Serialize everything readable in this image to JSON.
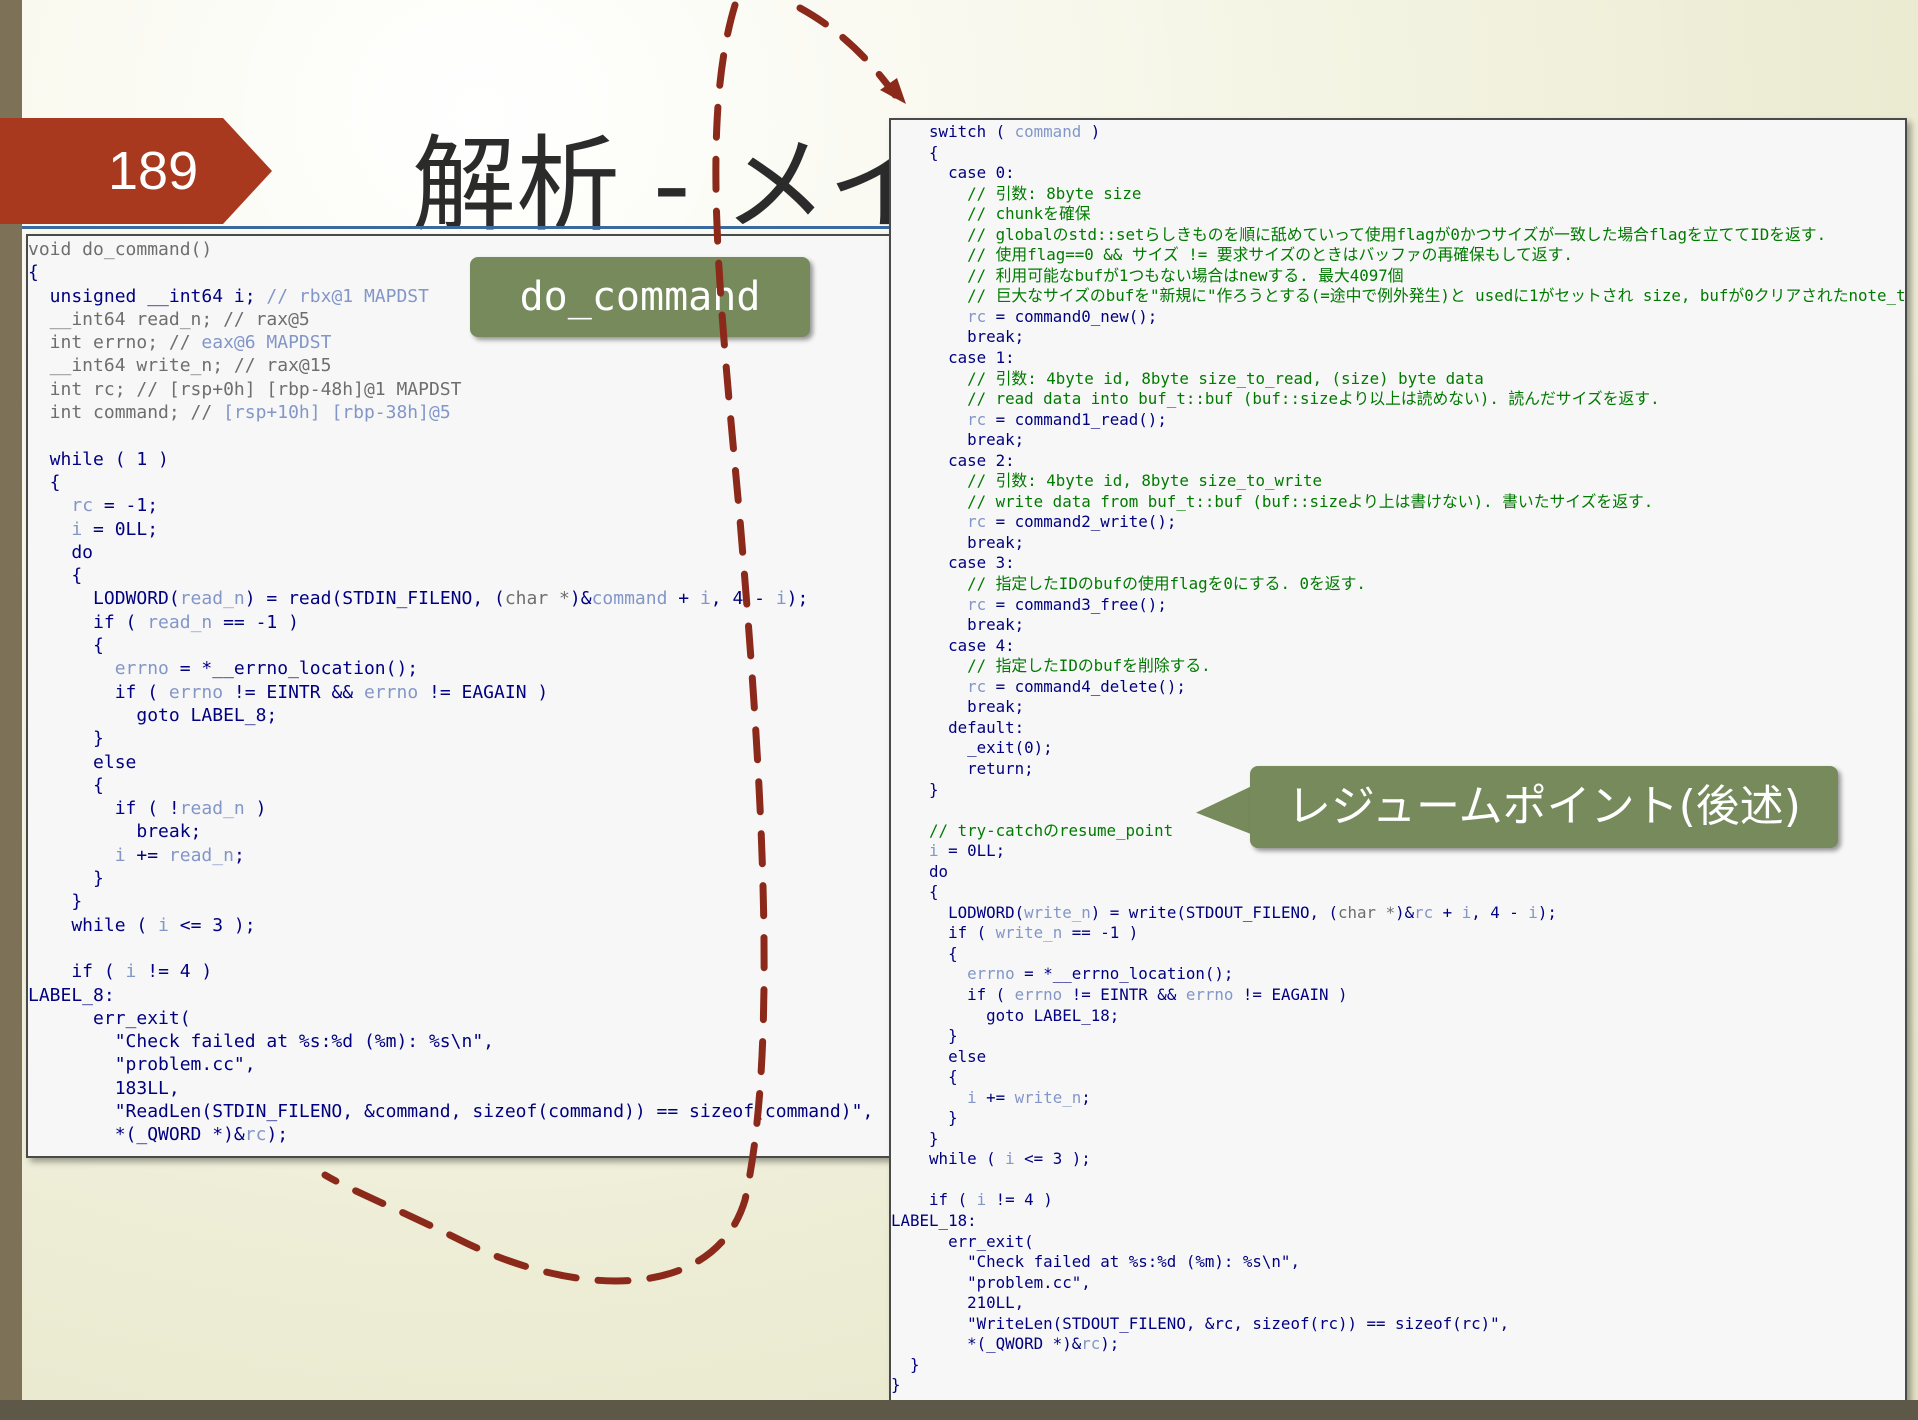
{
  "slide": {
    "number": "189",
    "title": "解析 - メインの機能の解析"
  },
  "callouts": {
    "do_command": "do_command",
    "resume_point": "レジュームポイント(後述)"
  },
  "colors": {
    "slide_number_tab": "#a8391f",
    "callout": "#768a5c",
    "arrow": "#8b2a1a",
    "code_keyword": "#000080",
    "code_variable": "#8296c8",
    "code_comment": "#007a00"
  },
  "code_left": {
    "lines": [
      [
        {
          "t": "void do_command()",
          "c": "dim"
        }
      ],
      [
        {
          "t": "{",
          "c": "kw"
        }
      ],
      [
        {
          "t": "  unsigned __int64 i; ",
          "c": "kw"
        },
        {
          "t": "// rbx@1 MAPDST",
          "c": "var"
        }
      ],
      [
        {
          "t": "  __int64 read_n; // rax@5",
          "c": "dim"
        }
      ],
      [
        {
          "t": "  int errno; // ",
          "c": "dim"
        },
        {
          "t": "eax@6 MAPDST",
          "c": "var"
        }
      ],
      [
        {
          "t": "  __int64 write_n; // rax@15",
          "c": "dim"
        }
      ],
      [
        {
          "t": "  int rc; // [rsp+0h] [rbp-48h]@1 MAPDST",
          "c": "dim"
        }
      ],
      [
        {
          "t": "  int command; // ",
          "c": "dim"
        },
        {
          "t": "[rsp+10h] [rbp-38h]@5",
          "c": "var"
        }
      ],
      [
        {
          "t": "",
          "c": "kw"
        }
      ],
      [
        {
          "t": "  while ( 1 )",
          "c": "kw"
        }
      ],
      [
        {
          "t": "  {",
          "c": "kw"
        }
      ],
      [
        {
          "t": "    ",
          "c": "kw"
        },
        {
          "t": "rc",
          "c": "var"
        },
        {
          "t": " = -1;",
          "c": "kw"
        }
      ],
      [
        {
          "t": "    ",
          "c": "kw"
        },
        {
          "t": "i",
          "c": "var"
        },
        {
          "t": " = 0LL;",
          "c": "kw"
        }
      ],
      [
        {
          "t": "    do",
          "c": "kw"
        }
      ],
      [
        {
          "t": "    {",
          "c": "kw"
        }
      ],
      [
        {
          "t": "      LODWORD(",
          "c": "kw"
        },
        {
          "t": "read_n",
          "c": "var"
        },
        {
          "t": ") = read(STDIN_FILENO, (",
          "c": "kw"
        },
        {
          "t": "char *",
          "c": "dim"
        },
        {
          "t": ")&",
          "c": "kw"
        },
        {
          "t": "command",
          "c": "var"
        },
        {
          "t": " + ",
          "c": "kw"
        },
        {
          "t": "i",
          "c": "var"
        },
        {
          "t": ", 4 - ",
          "c": "kw"
        },
        {
          "t": "i",
          "c": "var"
        },
        {
          "t": ");",
          "c": "kw"
        }
      ],
      [
        {
          "t": "      if ( ",
          "c": "kw"
        },
        {
          "t": "read_n",
          "c": "var"
        },
        {
          "t": " == -1 )",
          "c": "kw"
        }
      ],
      [
        {
          "t": "      {",
          "c": "kw"
        }
      ],
      [
        {
          "t": "        ",
          "c": "kw"
        },
        {
          "t": "errno",
          "c": "var"
        },
        {
          "t": " = *__errno_location();",
          "c": "kw"
        }
      ],
      [
        {
          "t": "        if ( ",
          "c": "kw"
        },
        {
          "t": "errno",
          "c": "var"
        },
        {
          "t": " != EINTR && ",
          "c": "kw"
        },
        {
          "t": "errno",
          "c": "var"
        },
        {
          "t": " != EAGAIN )",
          "c": "kw"
        }
      ],
      [
        {
          "t": "          goto LABEL_8;",
          "c": "kw"
        }
      ],
      [
        {
          "t": "      }",
          "c": "kw"
        }
      ],
      [
        {
          "t": "      else",
          "c": "kw"
        }
      ],
      [
        {
          "t": "      {",
          "c": "kw"
        }
      ],
      [
        {
          "t": "        if ( !",
          "c": "kw"
        },
        {
          "t": "read_n",
          "c": "var"
        },
        {
          "t": " )",
          "c": "kw"
        }
      ],
      [
        {
          "t": "          break;",
          "c": "kw"
        }
      ],
      [
        {
          "t": "        ",
          "c": "kw"
        },
        {
          "t": "i",
          "c": "var"
        },
        {
          "t": " += ",
          "c": "kw"
        },
        {
          "t": "read_n",
          "c": "var"
        },
        {
          "t": ";",
          "c": "kw"
        }
      ],
      [
        {
          "t": "      }",
          "c": "kw"
        }
      ],
      [
        {
          "t": "    }",
          "c": "kw"
        }
      ],
      [
        {
          "t": "    while ( ",
          "c": "kw"
        },
        {
          "t": "i",
          "c": "var"
        },
        {
          "t": " <= 3 );",
          "c": "kw"
        }
      ],
      [
        {
          "t": "",
          "c": "kw"
        }
      ],
      [
        {
          "t": "    if ( ",
          "c": "kw"
        },
        {
          "t": "i",
          "c": "var"
        },
        {
          "t": " != 4 )",
          "c": "kw"
        }
      ],
      [
        {
          "t": "LABEL_8:",
          "c": "kw"
        }
      ],
      [
        {
          "t": "      err_exit(",
          "c": "kw"
        }
      ],
      [
        {
          "t": "        \"Check failed at %s:%d (%m): %s\\n\",",
          "c": "kw"
        }
      ],
      [
        {
          "t": "        \"problem.cc\",",
          "c": "kw"
        }
      ],
      [
        {
          "t": "        183LL,",
          "c": "kw"
        }
      ],
      [
        {
          "t": "        \"ReadLen(STDIN_FILENO, &command, sizeof(command)) == sizeof(command)\",",
          "c": "kw"
        }
      ],
      [
        {
          "t": "        *(_QWORD *)&",
          "c": "kw"
        },
        {
          "t": "rc",
          "c": "var"
        },
        {
          "t": ");",
          "c": "kw"
        }
      ]
    ]
  },
  "code_right": {
    "lines": [
      [
        {
          "t": "    switch ( ",
          "c": "kw"
        },
        {
          "t": "command",
          "c": "var"
        },
        {
          "t": " )",
          "c": "kw"
        }
      ],
      [
        {
          "t": "    {",
          "c": "kw"
        }
      ],
      [
        {
          "t": "      case 0:",
          "c": "kw"
        }
      ],
      [
        {
          "t": "        // 引数: 8byte size",
          "c": "cmt"
        }
      ],
      [
        {
          "t": "        // chunkを確保",
          "c": "cmt"
        }
      ],
      [
        {
          "t": "        // globalのstd::setらしきものを順に舐めていって使用flagが0かつサイズが一致した場合flagを立ててIDを返す.",
          "c": "cmt"
        }
      ],
      [
        {
          "t": "        // 使用flag==0 && サイズ != 要求サイズのときはバッファの再確保もして返す.",
          "c": "cmt"
        }
      ],
      [
        {
          "t": "        // 利用可能なbufが1つもない場合はnewする. 最大4097個",
          "c": "cmt"
        }
      ],
      [
        {
          "t": "        // 巨大なサイズのbufを\"新規に\"作ろうとする(=途中で例外発生)と usedに1がセットされ size, bufが0クリアされたnote_tができる",
          "c": "cmt"
        }
      ],
      [
        {
          "t": "        ",
          "c": "kw"
        },
        {
          "t": "rc",
          "c": "var"
        },
        {
          "t": " = command0_new();",
          "c": "kw"
        }
      ],
      [
        {
          "t": "        break;",
          "c": "kw"
        }
      ],
      [
        {
          "t": "      case 1:",
          "c": "kw"
        }
      ],
      [
        {
          "t": "        // 引数: 4byte id, 8byte size_to_read, (size) byte data",
          "c": "cmt"
        }
      ],
      [
        {
          "t": "        // read data into buf_t::buf (buf::sizeより以上は読めない). 読んだサイズを返す.",
          "c": "cmt"
        }
      ],
      [
        {
          "t": "        ",
          "c": "kw"
        },
        {
          "t": "rc",
          "c": "var"
        },
        {
          "t": " = command1_read();",
          "c": "kw"
        }
      ],
      [
        {
          "t": "        break;",
          "c": "kw"
        }
      ],
      [
        {
          "t": "      case 2:",
          "c": "kw"
        }
      ],
      [
        {
          "t": "        // 引数: 4byte id, 8byte size_to_write",
          "c": "cmt"
        }
      ],
      [
        {
          "t": "        // write data from buf_t::buf (buf::sizeより上は書けない). 書いたサイズを返す.",
          "c": "cmt"
        }
      ],
      [
        {
          "t": "        ",
          "c": "kw"
        },
        {
          "t": "rc",
          "c": "var"
        },
        {
          "t": " = command2_write();",
          "c": "kw"
        }
      ],
      [
        {
          "t": "        break;",
          "c": "kw"
        }
      ],
      [
        {
          "t": "      case 3:",
          "c": "kw"
        }
      ],
      [
        {
          "t": "        // 指定したIDのbufの使用flagを0にする. 0を返す.",
          "c": "cmt"
        }
      ],
      [
        {
          "t": "        ",
          "c": "kw"
        },
        {
          "t": "rc",
          "c": "var"
        },
        {
          "t": " = command3_free();",
          "c": "kw"
        }
      ],
      [
        {
          "t": "        break;",
          "c": "kw"
        }
      ],
      [
        {
          "t": "      case 4:",
          "c": "kw"
        }
      ],
      [
        {
          "t": "        // 指定したIDのbufを削除する.",
          "c": "cmt"
        }
      ],
      [
        {
          "t": "        ",
          "c": "kw"
        },
        {
          "t": "rc",
          "c": "var"
        },
        {
          "t": " = command4_delete();",
          "c": "kw"
        }
      ],
      [
        {
          "t": "        break;",
          "c": "kw"
        }
      ],
      [
        {
          "t": "      default:",
          "c": "kw"
        }
      ],
      [
        {
          "t": "        _exit(0);",
          "c": "kw"
        }
      ],
      [
        {
          "t": "        return;",
          "c": "kw"
        }
      ],
      [
        {
          "t": "    }",
          "c": "kw"
        }
      ],
      [
        {
          "t": "",
          "c": "kw"
        }
      ],
      [
        {
          "t": "    // try-catchのresume_point",
          "c": "cmt"
        }
      ],
      [
        {
          "t": "    ",
          "c": "kw"
        },
        {
          "t": "i",
          "c": "var"
        },
        {
          "t": " = 0LL;",
          "c": "kw"
        }
      ],
      [
        {
          "t": "    do",
          "c": "kw"
        }
      ],
      [
        {
          "t": "    {",
          "c": "kw"
        }
      ],
      [
        {
          "t": "      LODWORD(",
          "c": "kw"
        },
        {
          "t": "write_n",
          "c": "var"
        },
        {
          "t": ") = write(STDOUT_FILENO, (",
          "c": "kw"
        },
        {
          "t": "char *",
          "c": "dim"
        },
        {
          "t": ")&",
          "c": "kw"
        },
        {
          "t": "rc",
          "c": "var"
        },
        {
          "t": " + ",
          "c": "kw"
        },
        {
          "t": "i",
          "c": "var"
        },
        {
          "t": ", 4 - ",
          "c": "kw"
        },
        {
          "t": "i",
          "c": "var"
        },
        {
          "t": ");",
          "c": "kw"
        }
      ],
      [
        {
          "t": "      if ( ",
          "c": "kw"
        },
        {
          "t": "write_n",
          "c": "var"
        },
        {
          "t": " == -1 )",
          "c": "kw"
        }
      ],
      [
        {
          "t": "      {",
          "c": "kw"
        }
      ],
      [
        {
          "t": "        ",
          "c": "kw"
        },
        {
          "t": "errno",
          "c": "var"
        },
        {
          "t": " = *__errno_location();",
          "c": "kw"
        }
      ],
      [
        {
          "t": "        if ( ",
          "c": "kw"
        },
        {
          "t": "errno",
          "c": "var"
        },
        {
          "t": " != EINTR && ",
          "c": "kw"
        },
        {
          "t": "errno",
          "c": "var"
        },
        {
          "t": " != EAGAIN )",
          "c": "kw"
        }
      ],
      [
        {
          "t": "          goto LABEL_18;",
          "c": "kw"
        }
      ],
      [
        {
          "t": "      }",
          "c": "kw"
        }
      ],
      [
        {
          "t": "      else",
          "c": "kw"
        }
      ],
      [
        {
          "t": "      {",
          "c": "kw"
        }
      ],
      [
        {
          "t": "        ",
          "c": "kw"
        },
        {
          "t": "i",
          "c": "var"
        },
        {
          "t": " += ",
          "c": "kw"
        },
        {
          "t": "write_n",
          "c": "var"
        },
        {
          "t": ";",
          "c": "kw"
        }
      ],
      [
        {
          "t": "      }",
          "c": "kw"
        }
      ],
      [
        {
          "t": "    }",
          "c": "kw"
        }
      ],
      [
        {
          "t": "    while ( ",
          "c": "kw"
        },
        {
          "t": "i",
          "c": "var"
        },
        {
          "t": " <= 3 );",
          "c": "kw"
        }
      ],
      [
        {
          "t": "",
          "c": "kw"
        }
      ],
      [
        {
          "t": "    if ( ",
          "c": "kw"
        },
        {
          "t": "i",
          "c": "var"
        },
        {
          "t": " != 4 )",
          "c": "kw"
        }
      ],
      [
        {
          "t": "LABEL_18:",
          "c": "kw"
        }
      ],
      [
        {
          "t": "      err_exit(",
          "c": "kw"
        }
      ],
      [
        {
          "t": "        \"Check failed at %s:%d (%m): %s\\n\",",
          "c": "kw"
        }
      ],
      [
        {
          "t": "        \"problem.cc\",",
          "c": "kw"
        }
      ],
      [
        {
          "t": "        210LL,",
          "c": "kw"
        }
      ],
      [
        {
          "t": "        \"WriteLen(STDOUT_FILENO, &rc, sizeof(rc)) == sizeof(rc)\",",
          "c": "kw"
        }
      ],
      [
        {
          "t": "        *(_QWORD *)&",
          "c": "kw"
        },
        {
          "t": "rc",
          "c": "var"
        },
        {
          "t": ");",
          "c": "kw"
        }
      ],
      [
        {
          "t": "  }",
          "c": "kw"
        }
      ],
      [
        {
          "t": "}",
          "c": "kw"
        }
      ]
    ]
  }
}
